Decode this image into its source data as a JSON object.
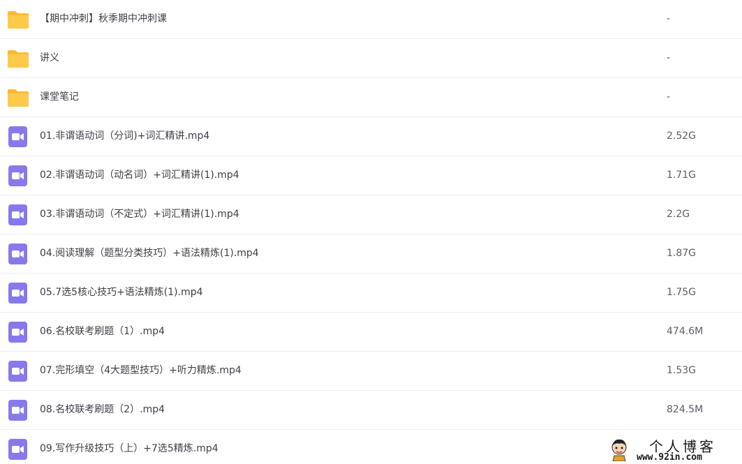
{
  "file_list": {
    "rows": [
      {
        "type": "folder",
        "icon": "folder-icon",
        "name": "【期中冲刺】秋季期中冲刺课",
        "size": "-"
      },
      {
        "type": "folder",
        "icon": "folder-icon",
        "name": "讲义",
        "size": "-"
      },
      {
        "type": "folder",
        "icon": "folder-icon",
        "name": "课堂笔记",
        "size": "-"
      },
      {
        "type": "video",
        "icon": "video-file-icon",
        "name": "01.非谓语动词（分词)+词汇精讲.mp4",
        "size": "2.52G"
      },
      {
        "type": "video",
        "icon": "video-file-icon",
        "name": "02.非谓语动词（动名词）+词汇精讲(1).mp4",
        "size": "1.71G"
      },
      {
        "type": "video",
        "icon": "video-file-icon",
        "name": "03.非谓语动词（不定式）+词汇精讲(1).mp4",
        "size": "2.2G"
      },
      {
        "type": "video",
        "icon": "video-file-icon",
        "name": "04.阅读理解（题型分类技巧）+语法精炼(1).mp4",
        "size": "1.87G"
      },
      {
        "type": "video",
        "icon": "video-file-icon",
        "name": "05.7选5核心技巧+语法精炼(1).mp4",
        "size": "1.75G"
      },
      {
        "type": "video",
        "icon": "video-file-icon",
        "name": "06.名校联考刷题（1）.mp4",
        "size": "474.6M"
      },
      {
        "type": "video",
        "icon": "video-file-icon",
        "name": "07.完形填空（4大题型技巧）+听力精炼.mp4",
        "size": "1.53G"
      },
      {
        "type": "video",
        "icon": "video-file-icon",
        "name": "08.名校联考刷题（2）.mp4",
        "size": "824.5M"
      },
      {
        "type": "video",
        "icon": "video-file-icon",
        "name": "09.写作升级技巧（上）+7选5精炼.mp4",
        "size": ""
      }
    ]
  },
  "watermark": {
    "title": "个人博客",
    "url": "www.92in.com"
  },
  "colors": {
    "folder": "#ffc94a",
    "folder_tab": "#ffb92e",
    "video": "#8779ec",
    "divider": "#ebeef2"
  }
}
